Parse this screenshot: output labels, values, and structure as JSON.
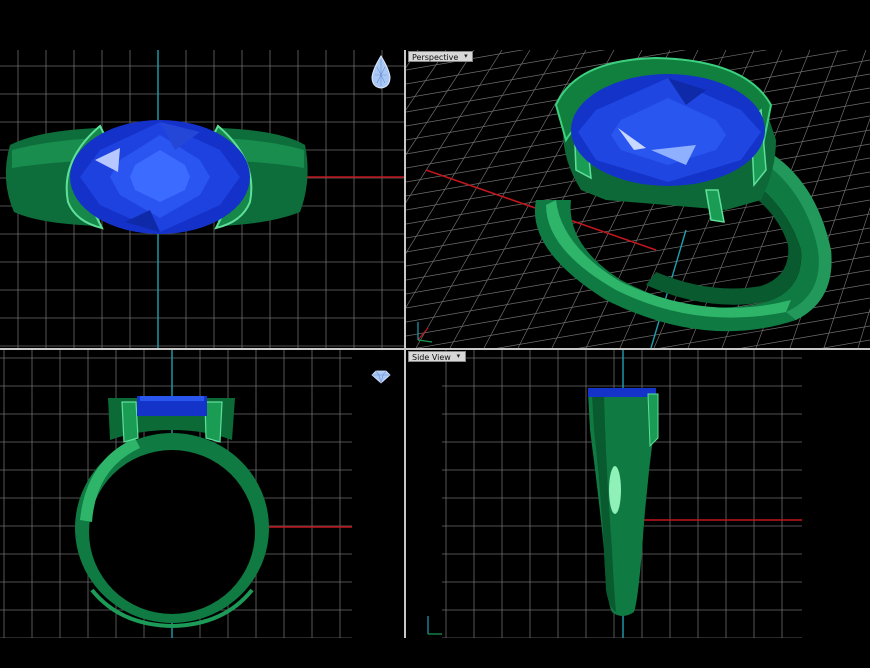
{
  "app": {
    "viewports": [
      {
        "id": "top",
        "label": ""
      },
      {
        "id": "perspective",
        "label": "Perspective"
      },
      {
        "id": "front",
        "label": ""
      },
      {
        "id": "side",
        "label": "Side View"
      }
    ]
  },
  "icons": {
    "top_view_gem": "pear-gem-icon",
    "front_view_gem": "round-gem-icon",
    "dropdown": "chevron-down-icon",
    "axis_gizmo": "axis-gizmo-icon"
  },
  "colors": {
    "background": "#000000",
    "grid": "#8a8a8a",
    "x_axis": "#c0161c",
    "y_axis": "#1f9fb0",
    "metal": "#0f7a42",
    "metal_light": "#5fe09a",
    "gem": "#1a3ee0",
    "gem_light": "#5f82ff",
    "divider": "#c8c8c8"
  }
}
